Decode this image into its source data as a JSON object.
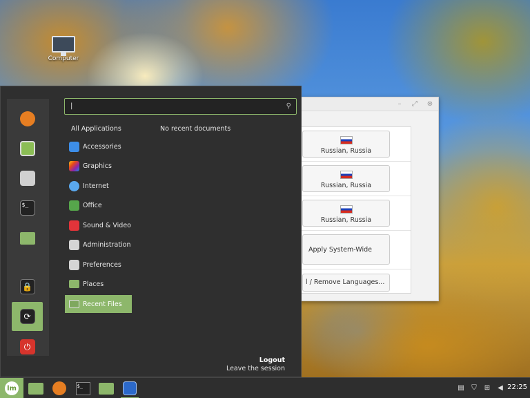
{
  "desktop": {
    "computer_label": "Computer"
  },
  "language_window": {
    "rows": [
      {
        "label": "Russian, Russia"
      },
      {
        "label": "Russian, Russia"
      },
      {
        "label": "Russian, Russia"
      }
    ],
    "apply_label": "Apply System-Wide",
    "install_label": "l / Remove Languages..."
  },
  "menu": {
    "search": {
      "value": "|"
    },
    "all_applications": "All Applications",
    "no_recent": "No recent documents",
    "favorites": [
      {
        "icon": "firefox-icon"
      },
      {
        "icon": "software-manager-icon"
      },
      {
        "icon": "system-settings-icon"
      },
      {
        "icon": "terminal-icon"
      },
      {
        "icon": "files-icon"
      },
      {
        "icon": "lock-icon"
      },
      {
        "icon": "logout-icon"
      },
      {
        "icon": "power-icon"
      }
    ],
    "categories": [
      {
        "label": "Accessories"
      },
      {
        "label": "Graphics"
      },
      {
        "label": "Internet"
      },
      {
        "label": "Office"
      },
      {
        "label": "Sound & Video"
      },
      {
        "label": "Administration"
      },
      {
        "label": "Preferences"
      },
      {
        "label": "Places"
      },
      {
        "label": "Recent Files"
      }
    ],
    "logout_title": "Logout",
    "logout_desc": "Leave the session"
  },
  "taskbar": {
    "clock": "22:25",
    "accent": "#8db76b"
  }
}
